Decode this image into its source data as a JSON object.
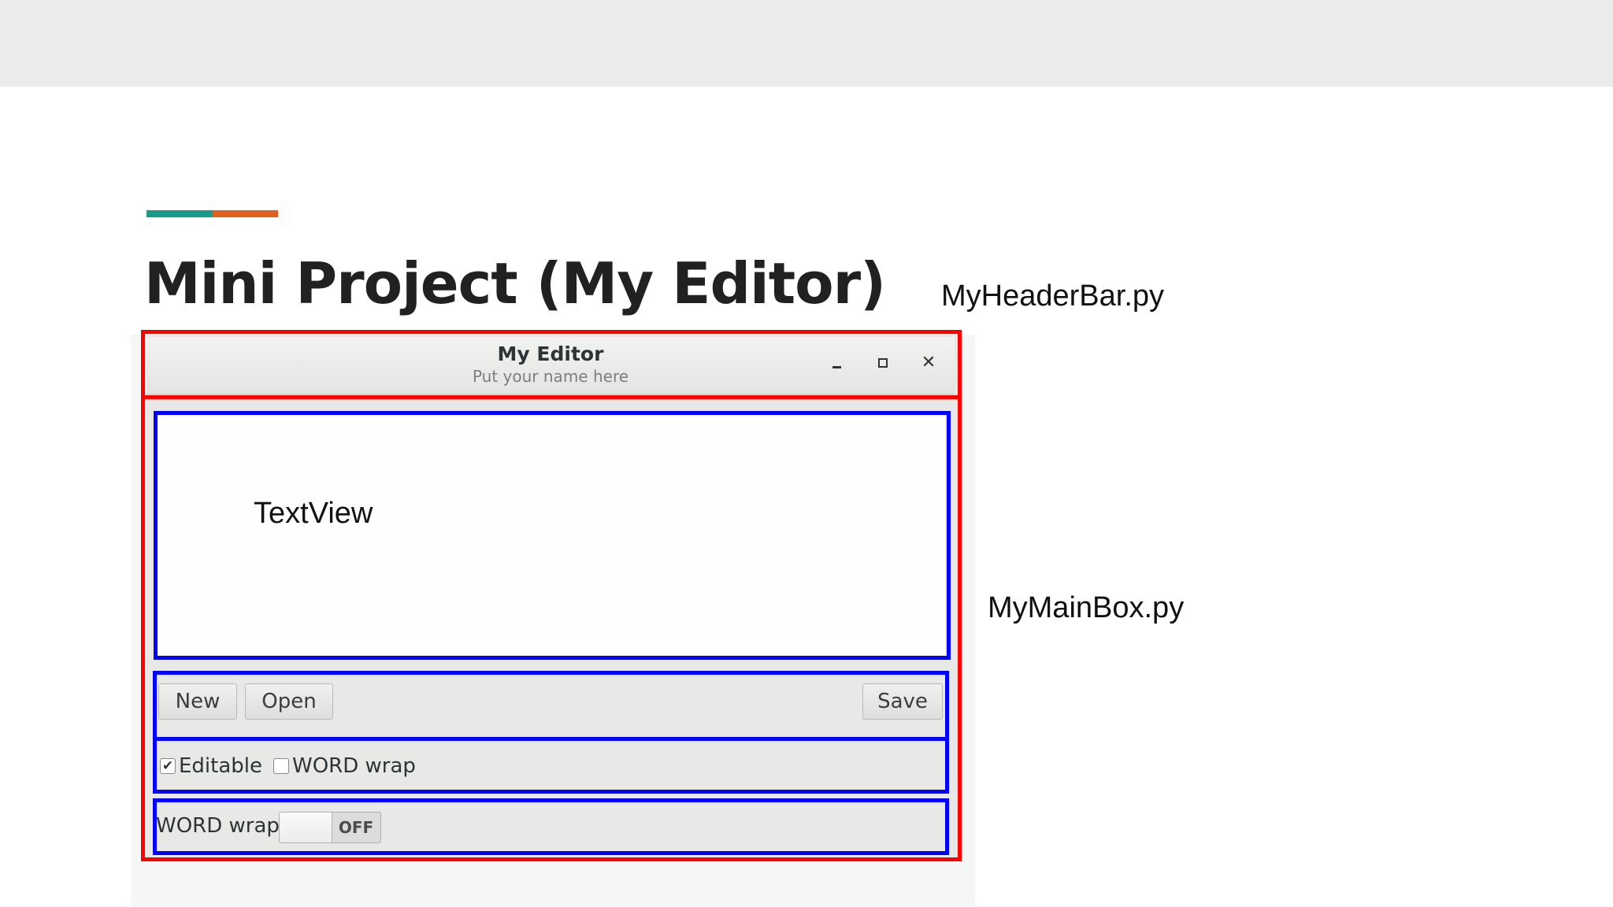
{
  "slide": {
    "title": "Mini Project (My Editor)",
    "accent_colors": [
      "#1a9a8a",
      "#e0601c"
    ],
    "annotations": {
      "header_file": "MyHeaderBar.py",
      "mainbox_file": "MyMainBox.py",
      "textview": "TextView"
    },
    "highlight_colors": {
      "outer": "#ff0000",
      "inner": "#0000ff"
    }
  },
  "window": {
    "title": "My Editor",
    "subtitle": "Put your name here",
    "controls": {
      "minimize": "minimize-icon",
      "maximize": "maximize-icon",
      "close": "✕"
    }
  },
  "buttons": {
    "new": "New",
    "open": "Open",
    "save": "Save"
  },
  "checks": {
    "editable": {
      "label": "Editable",
      "checked": true,
      "mark": "✔"
    },
    "word_wrap": {
      "label": "WORD wrap",
      "checked": false,
      "mark": ""
    }
  },
  "switch_row": {
    "label": "WORD wrap",
    "state": "OFF"
  }
}
